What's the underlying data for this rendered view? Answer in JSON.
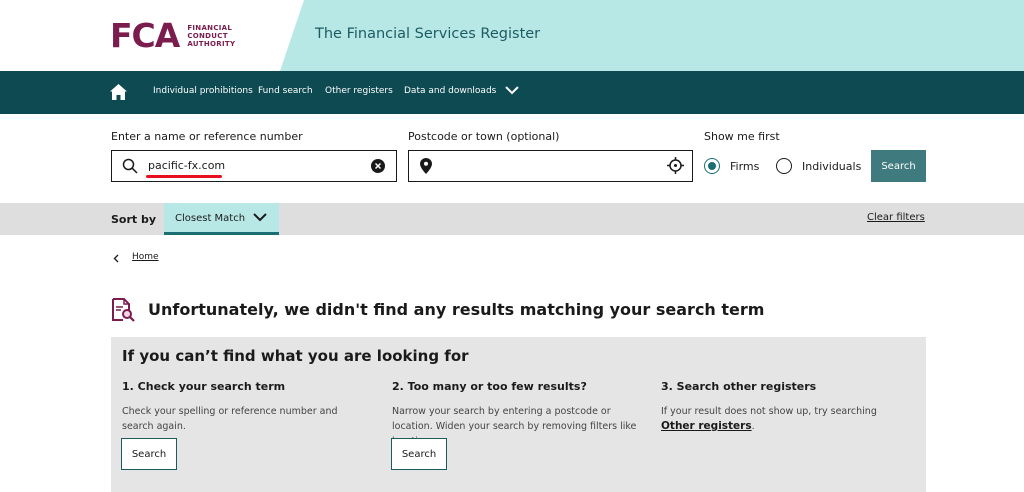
{
  "header": {
    "logo_mark": "FCA",
    "logo_text_lines": [
      "FINANCIAL",
      "CONDUCT",
      "AUTHORITY"
    ],
    "site_title": "The Financial Services Register"
  },
  "nav": {
    "items": [
      {
        "label": "Individual prohibitions"
      },
      {
        "label": "Fund search"
      },
      {
        "label": "Other registers"
      },
      {
        "label": "Data and downloads"
      }
    ]
  },
  "search": {
    "name_label": "Enter a name or reference number",
    "name_value": "pacific-fx.com",
    "postcode_label": "Postcode or town (optional)",
    "postcode_value": "",
    "show_first_label": "Show me first",
    "options": [
      {
        "label": "Firms",
        "selected": true
      },
      {
        "label": "Individuals",
        "selected": false
      }
    ],
    "button_label": "Search"
  },
  "sort": {
    "label": "Sort by",
    "selected": "Closest Match",
    "clear_label": "Clear filters"
  },
  "breadcrumb": {
    "home": "Home"
  },
  "results": {
    "no_results_message": "Unfortunately, we didn't find any results matching your search term"
  },
  "help": {
    "title": "If you can’t find what you are looking for",
    "columns": [
      {
        "heading": "1. Check your search term",
        "text": "Check your spelling or reference number and search again.",
        "button": "Search"
      },
      {
        "heading": "2. Too many or too few results?",
        "text": "Narrow your search by entering a postcode or location. Widen your search by removing filters like location.",
        "button": "Search"
      },
      {
        "heading": "3. Search other registers",
        "text_before": "If your result does not show up, try searching ",
        "link": "Other registers",
        "text_after": "."
      }
    ]
  },
  "colors": {
    "brand": "#7a1d4e",
    "nav_bg": "#0d4a52",
    "header_accent": "#b8e8e6",
    "button_bg": "#3f7b7e"
  }
}
